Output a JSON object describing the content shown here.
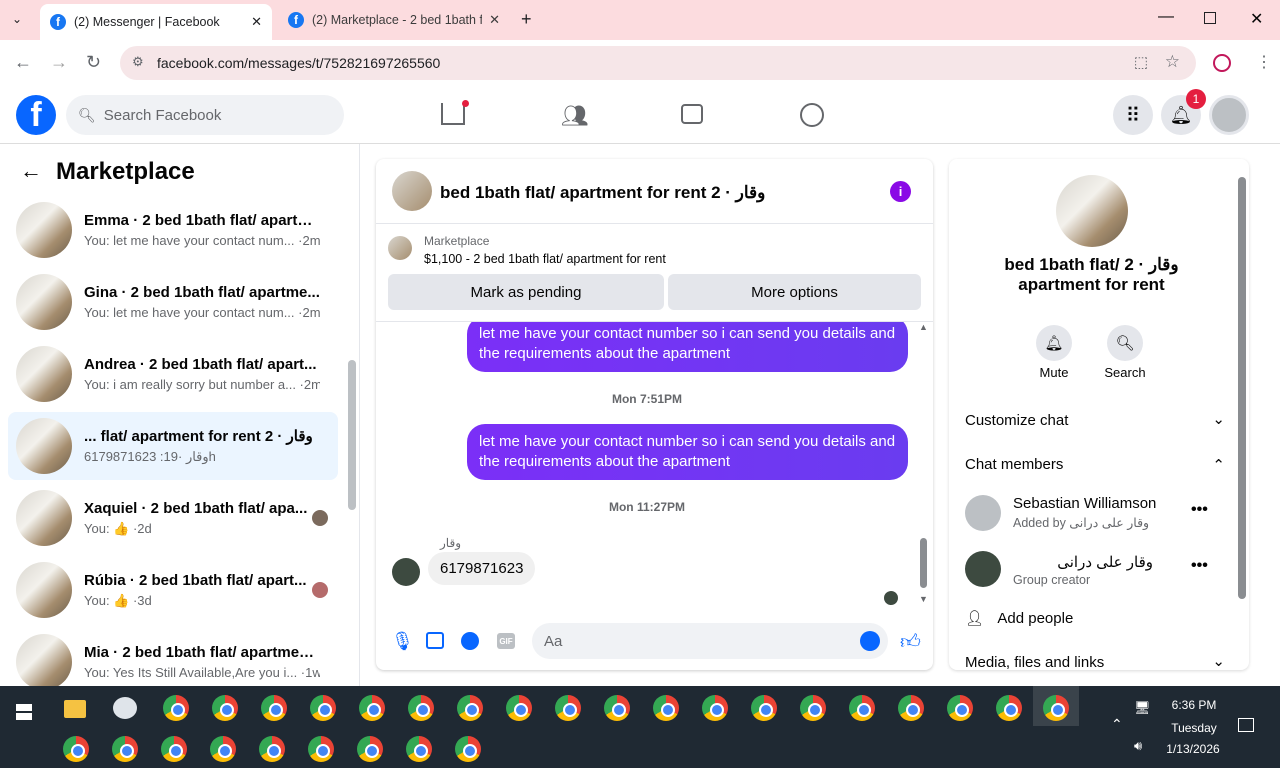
{
  "browser": {
    "tabs": [
      {
        "title": "(2) Messenger | Facebook"
      },
      {
        "title": "(2) Marketplace - 2 bed 1bath f"
      }
    ],
    "url": "facebook.com/messages/t/752821697265560"
  },
  "header": {
    "search_placeholder": "Search Facebook",
    "notification_count": "1"
  },
  "left_panel": {
    "title": "Marketplace",
    "conversations": [
      {
        "name": "Emma · 2 bed 1bath flat/ apartm...",
        "last": "You: let me have your contact num... ·2m"
      },
      {
        "name": "Gina · 2 bed 1bath flat/ apartme...",
        "last": "You: let me have your contact num... ·2m"
      },
      {
        "name": "Andrea · 2 bed 1bath flat/ apart...",
        "last": "You: i am really sorry but number a... ·2m"
      },
      {
        "name": "... flat/ apartment for rent 2 · وقار",
        "last": "6179871623 :وقار ·19h"
      },
      {
        "name": "Xaquiel · 2 bed 1bath flat/ apa...",
        "last": "You: 👍 ·2d"
      },
      {
        "name": "Rúbia · 2 bed 1bath flat/ apart...",
        "last": "You: 👍 ·3d"
      },
      {
        "name": "Mia · 2 bed 1bath flat/ apartmen...",
        "last": "You: Yes Its Still Available,Are you i... ·1w"
      }
    ]
  },
  "chat": {
    "title": "bed 1bath flat/ apartment for rent 2 · وقار",
    "listing_label": "Marketplace",
    "listing_price": "$1,100 - 2 bed 1bath flat/ apartment for rent",
    "mark_pending": "Mark as pending",
    "more_options": "More options",
    "msg1": "let me have your contact number so i can send you details and the requirements about the apartment",
    "time1": "Mon 7:51PM",
    "msg2": "let me have your contact number so i can send you details and the requirements about the apartment",
    "time2": "Mon 11:27PM",
    "sender": "وقار",
    "incoming": "6179871623",
    "composer_placeholder": "Aa"
  },
  "right_panel": {
    "title": "bed 1bath flat/ 2 · وقار apartment for rent",
    "mute": "Mute",
    "search": "Search",
    "customize": "Customize chat",
    "members_header": "Chat members",
    "members": [
      {
        "name": "Sebastian Williamson",
        "sub": "Added by وقار علی درانی"
      },
      {
        "name": "وقار علی درانی",
        "sub": "Group creator"
      }
    ],
    "add_people": "Add people",
    "media": "Media, files and links"
  },
  "taskbar": {
    "time": "6:36 PM",
    "day": "Tuesday",
    "date": "1/13/2026"
  }
}
